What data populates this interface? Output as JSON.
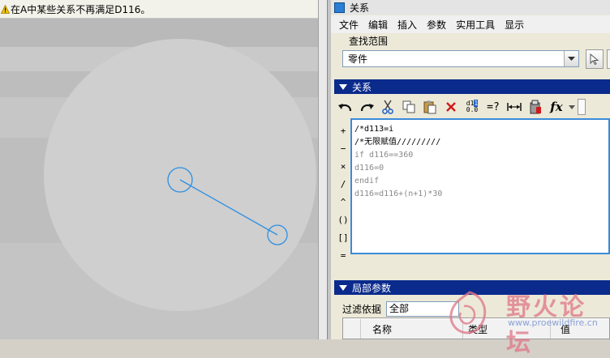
{
  "warning": {
    "text": "在A中某些关系不再满足D116。"
  },
  "dialog": {
    "title": "关系",
    "menu": [
      "文件",
      "编辑",
      "插入",
      "参数",
      "实用工具",
      "显示"
    ],
    "scope_label": "查找范围",
    "scope_value": "零件",
    "relations_header": "关系",
    "local_params_header": "局部参数",
    "filter_label": "过滤依据",
    "filter_value": "全部",
    "columns": [
      "名称",
      "类型",
      "值"
    ],
    "operators": [
      "+",
      "−",
      "×",
      "/",
      "^",
      "()",
      "[]",
      "="
    ],
    "editor_lines": [
      {
        "text": "/*d113=i",
        "muted": false
      },
      {
        "text": "/*无限赋值/////////",
        "muted": false
      },
      {
        "text": "if d116==360",
        "muted": true
      },
      {
        "text": "d116=0",
        "muted": true
      },
      {
        "text": "endif",
        "muted": true
      },
      {
        "text": "d116=d116+(n+1)*30",
        "muted": true
      }
    ],
    "toolbar_icons": [
      "undo-icon",
      "redo-icon",
      "cut-icon",
      "copy-icon",
      "paste-icon",
      "delete-icon",
      "switch-symbols-icon",
      "evaluate-icon",
      "measure-icon",
      "verify-icon",
      "function-icon"
    ]
  },
  "watermark": {
    "brand": "野火论坛",
    "url": "www.proewildfire.cn"
  },
  "colors": {
    "section_header": "#0a2a8c",
    "sketch_line": "#2e8fe0",
    "editor_border": "#3c8ad8"
  }
}
